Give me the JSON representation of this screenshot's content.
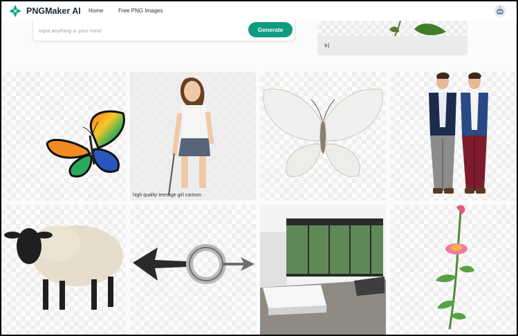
{
  "header": {
    "brand": "PNGMaker AI",
    "nav": [
      "Home",
      "Free PNG Images"
    ]
  },
  "prompt": {
    "placeholder": "Input anything in your mind",
    "generate_label": "Generate"
  },
  "side_panel": {
    "input_text": "s"
  },
  "gallery": {
    "hover_caption": "high quality teenage girl cartoon"
  },
  "colors": {
    "accent": "#0e9b82",
    "logo": "#17a98d"
  }
}
